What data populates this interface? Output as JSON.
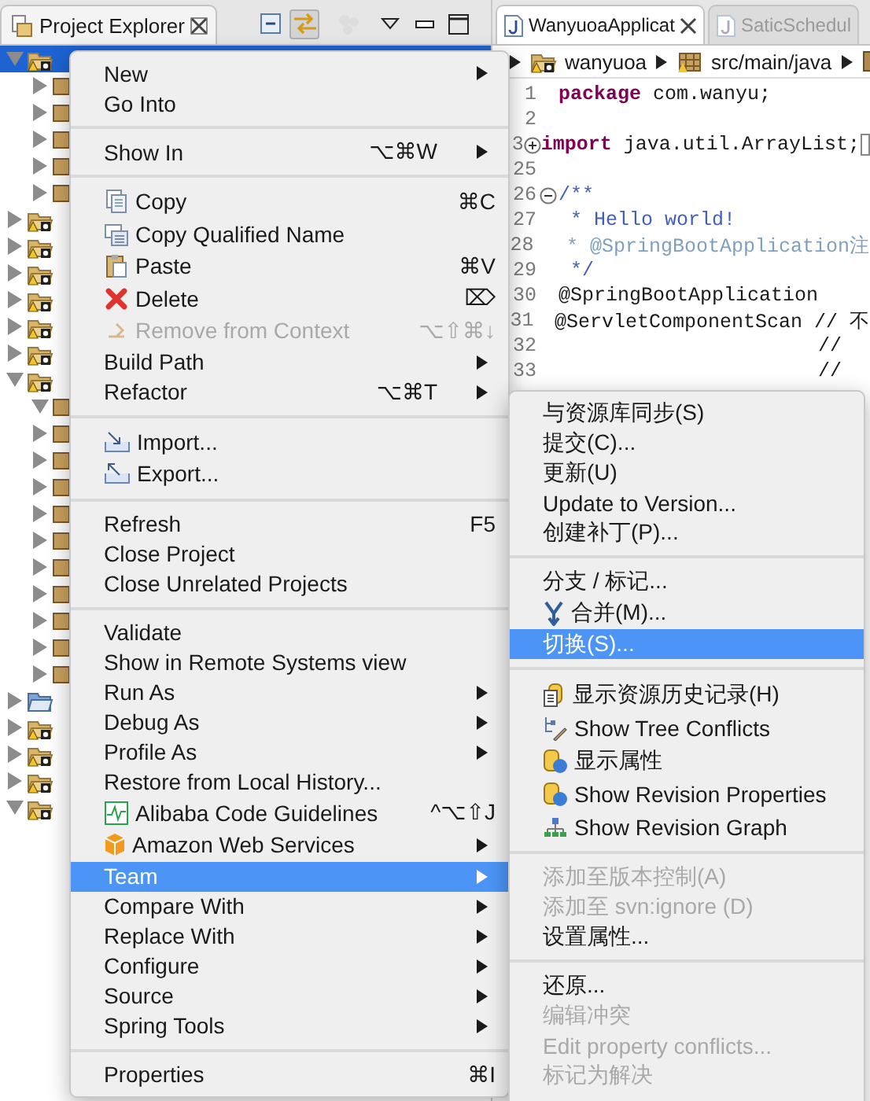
{
  "project_explorer": {
    "title": "Project Explorer",
    "link_with_editor": true
  },
  "tree": [
    {
      "kind": "project",
      "expanded": true,
      "selected": true,
      "children": [
        {
          "kind": "package",
          "expanded": false,
          "selected": false
        },
        {
          "kind": "package",
          "expanded": false,
          "selected": false
        },
        {
          "kind": "package",
          "expanded": false,
          "selected": false
        },
        {
          "kind": "package",
          "expanded": false,
          "selected": false
        },
        {
          "kind": "package",
          "expanded": false,
          "selected": false
        }
      ]
    },
    {
      "kind": "project",
      "expanded": false,
      "selected": false
    },
    {
      "kind": "project",
      "expanded": false,
      "selected": false
    },
    {
      "kind": "project",
      "expanded": false,
      "selected": false
    },
    {
      "kind": "project",
      "expanded": false,
      "selected": false
    },
    {
      "kind": "project",
      "expanded": false,
      "selected": false
    },
    {
      "kind": "project",
      "expanded": false,
      "selected": false
    },
    {
      "kind": "project",
      "expanded": true,
      "selected": false,
      "children": [
        {
          "kind": "package",
          "expanded": true,
          "selected": false
        },
        {
          "kind": "package",
          "expanded": false,
          "selected": false
        },
        {
          "kind": "package",
          "expanded": false,
          "selected": false
        },
        {
          "kind": "package",
          "expanded": false,
          "selected": false
        },
        {
          "kind": "package",
          "expanded": false,
          "selected": false
        },
        {
          "kind": "package",
          "expanded": false,
          "selected": false
        },
        {
          "kind": "package",
          "expanded": false,
          "selected": false
        },
        {
          "kind": "package",
          "expanded": false,
          "selected": false
        },
        {
          "kind": "package",
          "expanded": false,
          "selected": false
        },
        {
          "kind": "package",
          "expanded": false,
          "selected": false
        },
        {
          "kind": "package",
          "expanded": false,
          "selected": false
        }
      ]
    },
    {
      "kind": "folder",
      "expanded": false,
      "selected": false
    },
    {
      "kind": "project",
      "expanded": false,
      "selected": false
    },
    {
      "kind": "project",
      "expanded": false,
      "selected": false
    },
    {
      "kind": "project",
      "expanded": false,
      "selected": false
    },
    {
      "kind": "project",
      "expanded": true,
      "selected": false
    }
  ],
  "editor_tabs": [
    {
      "label": "WanyuoaApplicat",
      "selected": true
    },
    {
      "label": "SaticSchedul",
      "selected": false
    }
  ],
  "breadcrumb": [
    {
      "label": "wanyuoa",
      "kind": "project"
    },
    {
      "label": "src/main/java",
      "kind": "source-folder"
    },
    {
      "kind": "package"
    }
  ],
  "code": [
    {
      "number": "1",
      "text": "**package** com.wanyu;",
      "kind": "code"
    },
    {
      "number": "2"
    },
    {
      "number": "3",
      "text": "**import** java.util.ArrayList;",
      "kind": "code",
      "folded": true
    },
    {
      "number": "25"
    },
    {
      "number": "26",
      "text": "/**",
      "kind": "doc",
      "folded": false
    },
    {
      "number": "27",
      "text": " * Hello world!",
      "kind": "doc"
    },
    {
      "number": "28",
      "text": " * @SpringBootApplication注",
      "kind": "doc-tag"
    },
    {
      "number": "29",
      "text": " */",
      "kind": "doc"
    },
    {
      "number": "30",
      "text": "@SpringBootApplication",
      "kind": "code"
    },
    {
      "number": "31",
      "text": "@ServletComponentScan // 不",
      "kind": "code"
    },
    {
      "number": "32",
      "text": "                      //",
      "kind": "code"
    },
    {
      "number": "33",
      "text": "                      //",
      "kind": "code"
    }
  ],
  "menu": {
    "groups": [
      {
        "items": [
          {
            "label": "New",
            "submenu": true,
            "disabled": false,
            "selected": false
          },
          {
            "label": "Go Into",
            "submenu": false,
            "disabled": false,
            "selected": false
          }
        ]
      },
      {
        "items": [
          {
            "label": "Show In",
            "shortcut": "⌥⌘W",
            "submenu": true,
            "disabled": false,
            "selected": false
          }
        ]
      },
      {
        "items": [
          {
            "label": "Copy",
            "shortcut": "⌘C",
            "submenu": false,
            "disabled": false,
            "selected": false
          },
          {
            "label": "Copy Qualified Name",
            "submenu": false,
            "disabled": false,
            "selected": false
          },
          {
            "label": "Paste",
            "shortcut": "⌘V",
            "submenu": false,
            "disabled": false,
            "selected": false
          },
          {
            "label": "Delete",
            "shortcut": "⌦",
            "submenu": false,
            "disabled": false,
            "selected": false
          },
          {
            "label": "Remove from Context",
            "shortcut": "⌥⇧⌘↓",
            "submenu": false,
            "disabled": true,
            "selected": false
          },
          {
            "label": "Build Path",
            "submenu": true,
            "disabled": false,
            "selected": false
          },
          {
            "label": "Refactor",
            "shortcut": "⌥⌘T",
            "submenu": true,
            "disabled": false,
            "selected": false
          }
        ]
      },
      {
        "items": [
          {
            "label": "Import...",
            "submenu": false,
            "disabled": false,
            "selected": false
          },
          {
            "label": "Export...",
            "submenu": false,
            "disabled": false,
            "selected": false
          }
        ]
      },
      {
        "items": [
          {
            "label": "Refresh",
            "shortcut": "F5",
            "submenu": false,
            "disabled": false,
            "selected": false
          },
          {
            "label": "Close Project",
            "submenu": false,
            "disabled": false,
            "selected": false
          },
          {
            "label": "Close Unrelated Projects",
            "submenu": false,
            "disabled": false,
            "selected": false
          }
        ]
      },
      {
        "items": [
          {
            "label": "Validate",
            "submenu": false,
            "disabled": false,
            "selected": false
          },
          {
            "label": "Show in Remote Systems view",
            "submenu": false,
            "disabled": false,
            "selected": false
          },
          {
            "label": "Run As",
            "submenu": true,
            "disabled": false,
            "selected": false
          },
          {
            "label": "Debug As",
            "submenu": true,
            "disabled": false,
            "selected": false
          },
          {
            "label": "Profile As",
            "submenu": true,
            "disabled": false,
            "selected": false
          },
          {
            "label": "Restore from Local History...",
            "submenu": false,
            "disabled": false,
            "selected": false
          },
          {
            "label": "Alibaba Code Guidelines",
            "shortcut": "^⌥⇧J",
            "submenu": false,
            "disabled": false,
            "selected": false
          },
          {
            "label": "Amazon Web Services",
            "submenu": true,
            "disabled": false,
            "selected": false
          },
          {
            "label": "Team",
            "submenu": true,
            "disabled": false,
            "selected": true
          },
          {
            "label": "Compare With",
            "submenu": true,
            "disabled": false,
            "selected": false
          },
          {
            "label": "Replace With",
            "submenu": true,
            "disabled": false,
            "selected": false
          },
          {
            "label": "Configure",
            "submenu": true,
            "disabled": false,
            "selected": false
          },
          {
            "label": "Source",
            "submenu": true,
            "disabled": false,
            "selected": false
          },
          {
            "label": "Spring Tools",
            "submenu": true,
            "disabled": false,
            "selected": false
          }
        ]
      },
      {
        "items": [
          {
            "label": "Properties",
            "shortcut": "⌘I",
            "submenu": false,
            "disabled": false,
            "selected": false
          }
        ]
      }
    ]
  },
  "team_submenu": {
    "groups": [
      {
        "items": [
          {
            "label": "与资源库同步(S)",
            "disabled": false,
            "selected": false
          },
          {
            "label": "提交(C)...",
            "disabled": false,
            "selected": false
          },
          {
            "label": "更新(U)",
            "disabled": false,
            "selected": false
          },
          {
            "label": "Update to Version...",
            "disabled": false,
            "selected": false
          },
          {
            "label": "创建补丁(P)...",
            "disabled": false,
            "selected": false
          }
        ]
      },
      {
        "items": [
          {
            "label": "分支 / 标记...",
            "disabled": false,
            "selected": false
          },
          {
            "label": "合并(M)...",
            "disabled": false,
            "selected": false
          },
          {
            "label": "切换(S)...",
            "disabled": false,
            "selected": true
          }
        ]
      },
      {
        "items": [
          {
            "label": "显示资源历史记录(H)",
            "disabled": false,
            "selected": false
          },
          {
            "label": "Show Tree Conflicts",
            "disabled": false,
            "selected": false
          },
          {
            "label": "显示属性",
            "disabled": false,
            "selected": false
          },
          {
            "label": "Show Revision Properties",
            "disabled": false,
            "selected": false
          },
          {
            "label": "Show Revision Graph",
            "disabled": false,
            "selected": false
          }
        ]
      },
      {
        "items": [
          {
            "label": "添加至版本控制(A)",
            "disabled": true,
            "selected": false
          },
          {
            "label": "添加至 svn:ignore (D)",
            "disabled": true,
            "selected": false
          },
          {
            "label": "设置属性...",
            "disabled": false,
            "selected": false
          }
        ]
      },
      {
        "items": [
          {
            "label": "还原...",
            "disabled": false,
            "selected": false
          },
          {
            "label": "编辑冲突",
            "disabled": true,
            "selected": false
          },
          {
            "label": "Edit property conflicts...",
            "disabled": true,
            "selected": false
          },
          {
            "label": "标记为解决",
            "disabled": true,
            "selected": false
          }
        ]
      }
    ]
  }
}
